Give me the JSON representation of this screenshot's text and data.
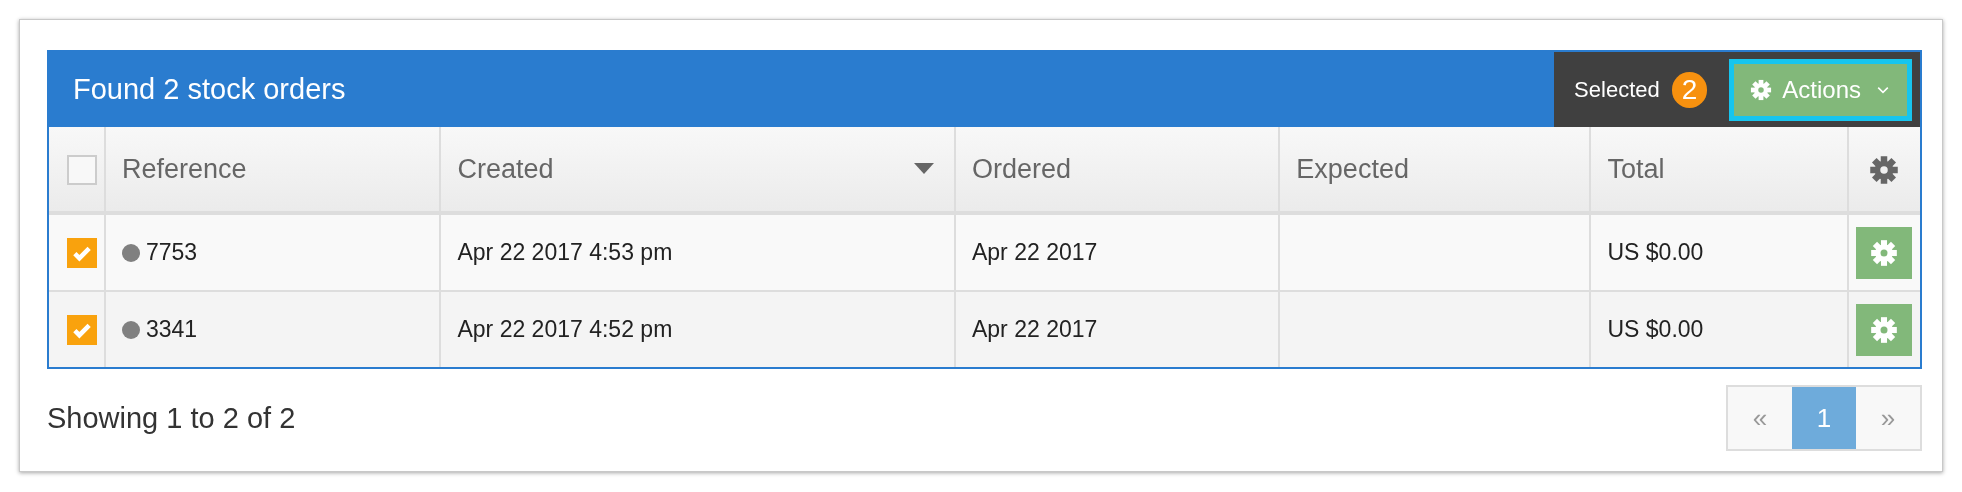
{
  "panel": {
    "title": "Found 2 stock orders",
    "selected_label": "Selected",
    "selected_count": "2",
    "actions_button": "Actions"
  },
  "table": {
    "select_all_checked": false,
    "columns": [
      {
        "label": "Reference",
        "sorted": false
      },
      {
        "label": "Created",
        "sorted": true
      },
      {
        "label": "Ordered",
        "sorted": false
      },
      {
        "label": "Expected",
        "sorted": false
      },
      {
        "label": "Total",
        "sorted": false
      }
    ],
    "rows": [
      {
        "checked": true,
        "color": "#808080",
        "reference": "7753",
        "created": "Apr 22 2017 4:53 pm",
        "ordered": "Apr 22 2017",
        "expected": "",
        "total": "US $0.00"
      },
      {
        "checked": true,
        "color": "#808080",
        "reference": "3341",
        "created": "Apr 22 2017 4:52 pm",
        "ordered": "Apr 22 2017",
        "expected": "",
        "total": "US $0.00"
      }
    ]
  },
  "footer": {
    "summary": "Showing 1 to 2 of 2"
  },
  "pagination": [
    {
      "label": "«",
      "selected": false
    },
    {
      "label": "1",
      "selected": true
    },
    {
      "label": "»",
      "selected": false
    }
  ]
}
